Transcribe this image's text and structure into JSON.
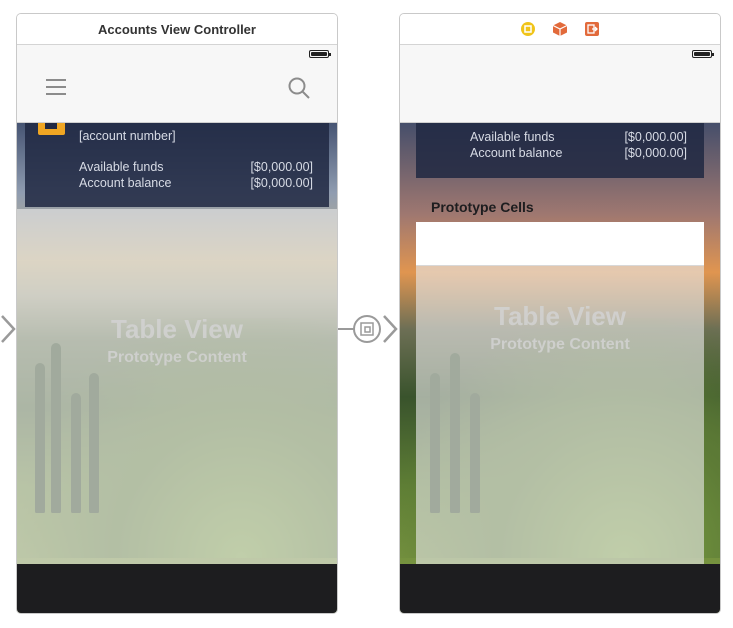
{
  "left_scene": {
    "title": "Accounts View Controller",
    "icons": [
      "menu-icon",
      "search-icon",
      "battery-icon",
      "account-icon"
    ],
    "card": {
      "account_number": "[account number]",
      "available_funds_label": "Available funds",
      "available_funds_value": "[$0,000.00]",
      "account_balance_label": "Account balance",
      "account_balance_value": "[$0,000.00]"
    },
    "table_view": {
      "title": "Table View",
      "subtitle": "Prototype Content"
    }
  },
  "right_scene": {
    "icons": [
      "view-controller-icon",
      "first-responder-icon",
      "exit-icon",
      "battery-icon"
    ],
    "card": {
      "available_funds_label": "Available funds",
      "available_funds_value": "[$0,000.00]",
      "account_balance_label": "Account balance",
      "account_balance_value": "[$0,000.00]"
    },
    "prototype_cells_label": "Prototype Cells",
    "table_view": {
      "title": "Table View",
      "subtitle": "Prototype Content"
    }
  },
  "segues": [
    "segue-arrow-in",
    "embed-segue-icon"
  ],
  "colors": {
    "card_bg": "#202842",
    "toolbar": "#1d1d1f",
    "object_yellow": "#f0c419",
    "object_orange": "#e26a3b",
    "account_icon": "#f0a623"
  }
}
